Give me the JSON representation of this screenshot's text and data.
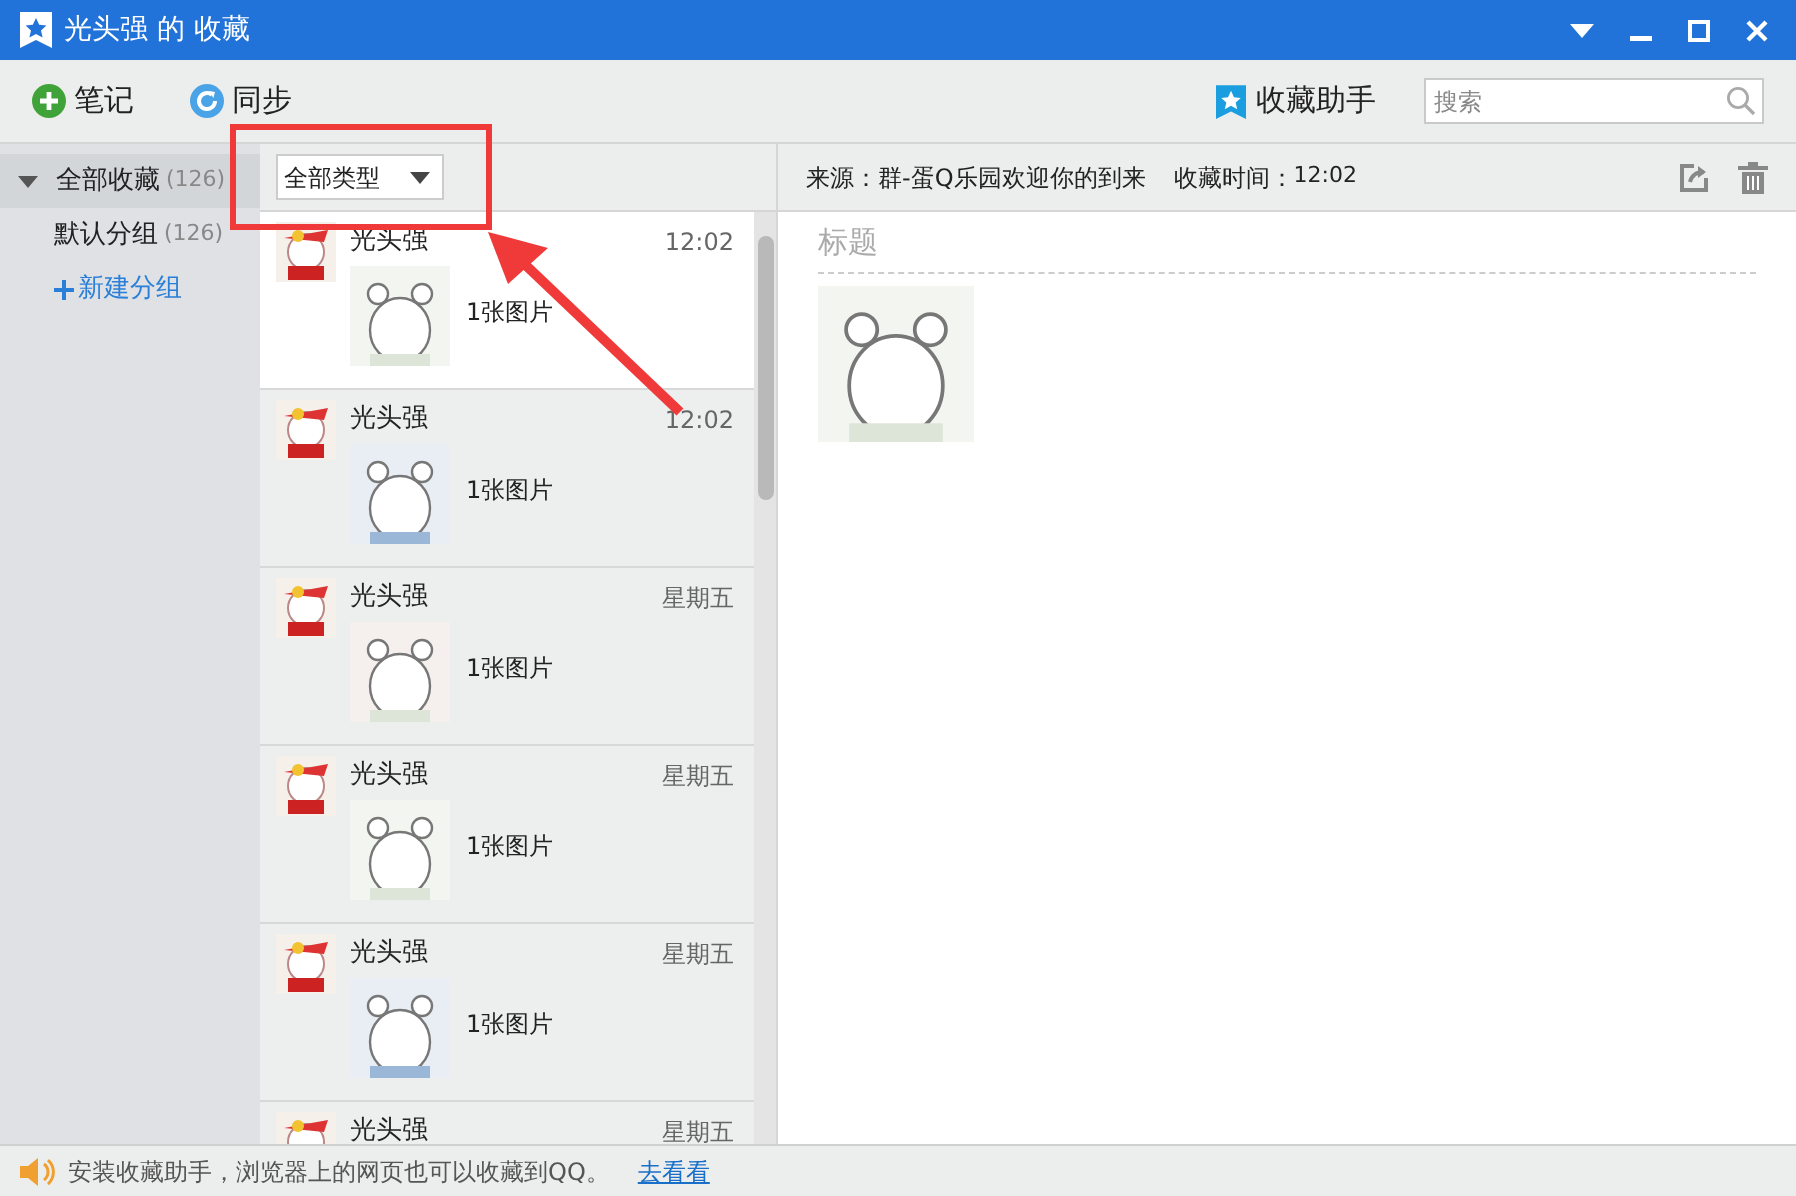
{
  "window": {
    "title": "光头强 的 收藏"
  },
  "toolbar": {
    "note_button": "笔记",
    "sync_button": "同步",
    "assistant_button": "收藏助手",
    "search": {
      "placeholder": "搜索"
    }
  },
  "sidebar": {
    "items": [
      {
        "label": "全部收藏",
        "count": "(126)",
        "expanded": true,
        "selected": true
      },
      {
        "label": "默认分组",
        "count": "(126)",
        "expanded": false,
        "selected": false
      }
    ],
    "new_group": "新建分组"
  },
  "filter": {
    "value": "全部类型"
  },
  "list": [
    {
      "name": "光头强",
      "time": "12:02",
      "summary": "1张图片",
      "selected": true
    },
    {
      "name": "光头强",
      "time": "12:02",
      "summary": "1张图片",
      "selected": false
    },
    {
      "name": "光头强",
      "time": "星期五",
      "summary": "1张图片",
      "selected": false
    },
    {
      "name": "光头强",
      "time": "星期五",
      "summary": "1张图片",
      "selected": false
    },
    {
      "name": "光头强",
      "time": "星期五",
      "summary": "1张图片",
      "selected": false
    },
    {
      "name": "光头强",
      "time": "星期五",
      "selected": false
    }
  ],
  "detail": {
    "source_label": "来源：",
    "source": "群-蛋Q乐园欢迎你的到来",
    "time_label": "收藏时间：",
    "time": "12:02",
    "title_placeholder": "标题"
  },
  "status_bar": {
    "message": "安装收藏助手，浏览器上的网页也可以收藏到QQ。",
    "link": "去看看"
  }
}
